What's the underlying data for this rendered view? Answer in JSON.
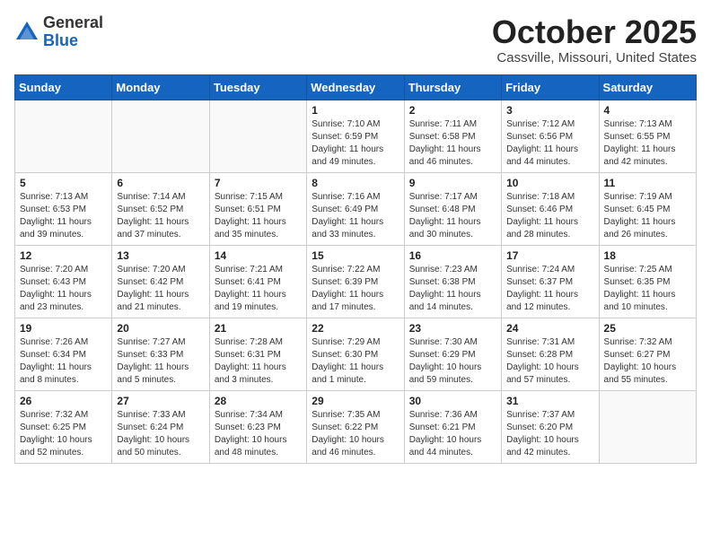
{
  "logo": {
    "general": "General",
    "blue": "Blue"
  },
  "header": {
    "month": "October 2025",
    "location": "Cassville, Missouri, United States"
  },
  "weekdays": [
    "Sunday",
    "Monday",
    "Tuesday",
    "Wednesday",
    "Thursday",
    "Friday",
    "Saturday"
  ],
  "weeks": [
    [
      {
        "day": "",
        "sunrise": "",
        "sunset": "",
        "daylight": ""
      },
      {
        "day": "",
        "sunrise": "",
        "sunset": "",
        "daylight": ""
      },
      {
        "day": "",
        "sunrise": "",
        "sunset": "",
        "daylight": ""
      },
      {
        "day": "1",
        "sunrise": "Sunrise: 7:10 AM",
        "sunset": "Sunset: 6:59 PM",
        "daylight": "Daylight: 11 hours and 49 minutes."
      },
      {
        "day": "2",
        "sunrise": "Sunrise: 7:11 AM",
        "sunset": "Sunset: 6:58 PM",
        "daylight": "Daylight: 11 hours and 46 minutes."
      },
      {
        "day": "3",
        "sunrise": "Sunrise: 7:12 AM",
        "sunset": "Sunset: 6:56 PM",
        "daylight": "Daylight: 11 hours and 44 minutes."
      },
      {
        "day": "4",
        "sunrise": "Sunrise: 7:13 AM",
        "sunset": "Sunset: 6:55 PM",
        "daylight": "Daylight: 11 hours and 42 minutes."
      }
    ],
    [
      {
        "day": "5",
        "sunrise": "Sunrise: 7:13 AM",
        "sunset": "Sunset: 6:53 PM",
        "daylight": "Daylight: 11 hours and 39 minutes."
      },
      {
        "day": "6",
        "sunrise": "Sunrise: 7:14 AM",
        "sunset": "Sunset: 6:52 PM",
        "daylight": "Daylight: 11 hours and 37 minutes."
      },
      {
        "day": "7",
        "sunrise": "Sunrise: 7:15 AM",
        "sunset": "Sunset: 6:51 PM",
        "daylight": "Daylight: 11 hours and 35 minutes."
      },
      {
        "day": "8",
        "sunrise": "Sunrise: 7:16 AM",
        "sunset": "Sunset: 6:49 PM",
        "daylight": "Daylight: 11 hours and 33 minutes."
      },
      {
        "day": "9",
        "sunrise": "Sunrise: 7:17 AM",
        "sunset": "Sunset: 6:48 PM",
        "daylight": "Daylight: 11 hours and 30 minutes."
      },
      {
        "day": "10",
        "sunrise": "Sunrise: 7:18 AM",
        "sunset": "Sunset: 6:46 PM",
        "daylight": "Daylight: 11 hours and 28 minutes."
      },
      {
        "day": "11",
        "sunrise": "Sunrise: 7:19 AM",
        "sunset": "Sunset: 6:45 PM",
        "daylight": "Daylight: 11 hours and 26 minutes."
      }
    ],
    [
      {
        "day": "12",
        "sunrise": "Sunrise: 7:20 AM",
        "sunset": "Sunset: 6:43 PM",
        "daylight": "Daylight: 11 hours and 23 minutes."
      },
      {
        "day": "13",
        "sunrise": "Sunrise: 7:20 AM",
        "sunset": "Sunset: 6:42 PM",
        "daylight": "Daylight: 11 hours and 21 minutes."
      },
      {
        "day": "14",
        "sunrise": "Sunrise: 7:21 AM",
        "sunset": "Sunset: 6:41 PM",
        "daylight": "Daylight: 11 hours and 19 minutes."
      },
      {
        "day": "15",
        "sunrise": "Sunrise: 7:22 AM",
        "sunset": "Sunset: 6:39 PM",
        "daylight": "Daylight: 11 hours and 17 minutes."
      },
      {
        "day": "16",
        "sunrise": "Sunrise: 7:23 AM",
        "sunset": "Sunset: 6:38 PM",
        "daylight": "Daylight: 11 hours and 14 minutes."
      },
      {
        "day": "17",
        "sunrise": "Sunrise: 7:24 AM",
        "sunset": "Sunset: 6:37 PM",
        "daylight": "Daylight: 11 hours and 12 minutes."
      },
      {
        "day": "18",
        "sunrise": "Sunrise: 7:25 AM",
        "sunset": "Sunset: 6:35 PM",
        "daylight": "Daylight: 11 hours and 10 minutes."
      }
    ],
    [
      {
        "day": "19",
        "sunrise": "Sunrise: 7:26 AM",
        "sunset": "Sunset: 6:34 PM",
        "daylight": "Daylight: 11 hours and 8 minutes."
      },
      {
        "day": "20",
        "sunrise": "Sunrise: 7:27 AM",
        "sunset": "Sunset: 6:33 PM",
        "daylight": "Daylight: 11 hours and 5 minutes."
      },
      {
        "day": "21",
        "sunrise": "Sunrise: 7:28 AM",
        "sunset": "Sunset: 6:31 PM",
        "daylight": "Daylight: 11 hours and 3 minutes."
      },
      {
        "day": "22",
        "sunrise": "Sunrise: 7:29 AM",
        "sunset": "Sunset: 6:30 PM",
        "daylight": "Daylight: 11 hours and 1 minute."
      },
      {
        "day": "23",
        "sunrise": "Sunrise: 7:30 AM",
        "sunset": "Sunset: 6:29 PM",
        "daylight": "Daylight: 10 hours and 59 minutes."
      },
      {
        "day": "24",
        "sunrise": "Sunrise: 7:31 AM",
        "sunset": "Sunset: 6:28 PM",
        "daylight": "Daylight: 10 hours and 57 minutes."
      },
      {
        "day": "25",
        "sunrise": "Sunrise: 7:32 AM",
        "sunset": "Sunset: 6:27 PM",
        "daylight": "Daylight: 10 hours and 55 minutes."
      }
    ],
    [
      {
        "day": "26",
        "sunrise": "Sunrise: 7:32 AM",
        "sunset": "Sunset: 6:25 PM",
        "daylight": "Daylight: 10 hours and 52 minutes."
      },
      {
        "day": "27",
        "sunrise": "Sunrise: 7:33 AM",
        "sunset": "Sunset: 6:24 PM",
        "daylight": "Daylight: 10 hours and 50 minutes."
      },
      {
        "day": "28",
        "sunrise": "Sunrise: 7:34 AM",
        "sunset": "Sunset: 6:23 PM",
        "daylight": "Daylight: 10 hours and 48 minutes."
      },
      {
        "day": "29",
        "sunrise": "Sunrise: 7:35 AM",
        "sunset": "Sunset: 6:22 PM",
        "daylight": "Daylight: 10 hours and 46 minutes."
      },
      {
        "day": "30",
        "sunrise": "Sunrise: 7:36 AM",
        "sunset": "Sunset: 6:21 PM",
        "daylight": "Daylight: 10 hours and 44 minutes."
      },
      {
        "day": "31",
        "sunrise": "Sunrise: 7:37 AM",
        "sunset": "Sunset: 6:20 PM",
        "daylight": "Daylight: 10 hours and 42 minutes."
      },
      {
        "day": "",
        "sunrise": "",
        "sunset": "",
        "daylight": ""
      }
    ]
  ]
}
